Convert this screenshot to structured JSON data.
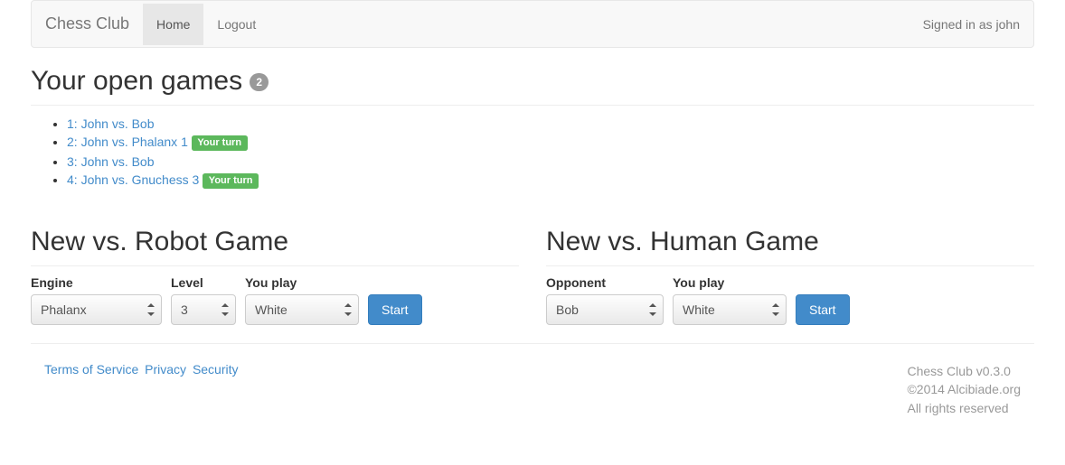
{
  "nav": {
    "brand": "Chess Club",
    "home": "Home",
    "logout": "Logout",
    "signed_in": "Signed in as john"
  },
  "open_games": {
    "title": "Your open games ",
    "count": "2",
    "items": [
      {
        "label": "1: John vs. Bob",
        "your_turn": false
      },
      {
        "label": "2: John vs. Phalanx 1",
        "your_turn": true
      },
      {
        "label": "3: John vs. Bob",
        "your_turn": false
      },
      {
        "label": "4: John vs. Gnuchess 3",
        "your_turn": true
      }
    ],
    "your_turn_label": "Your turn"
  },
  "robot": {
    "title": "New vs. Robot Game",
    "engine_label": "Engine",
    "engine_value": "Phalanx",
    "level_label": "Level",
    "level_value": "3",
    "play_label": "You play",
    "play_value": "White",
    "start": "Start"
  },
  "human": {
    "title": "New vs. Human Game",
    "opponent_label": "Opponent",
    "opponent_value": "Bob",
    "play_label": "You play",
    "play_value": "White",
    "start": "Start"
  },
  "footer": {
    "terms": "Terms of Service",
    "privacy": "Privacy",
    "security": "Security",
    "version": "Chess Club v0.3.0",
    "copyright": "©2014 Alcibiade.org",
    "rights": "All rights reserved"
  }
}
